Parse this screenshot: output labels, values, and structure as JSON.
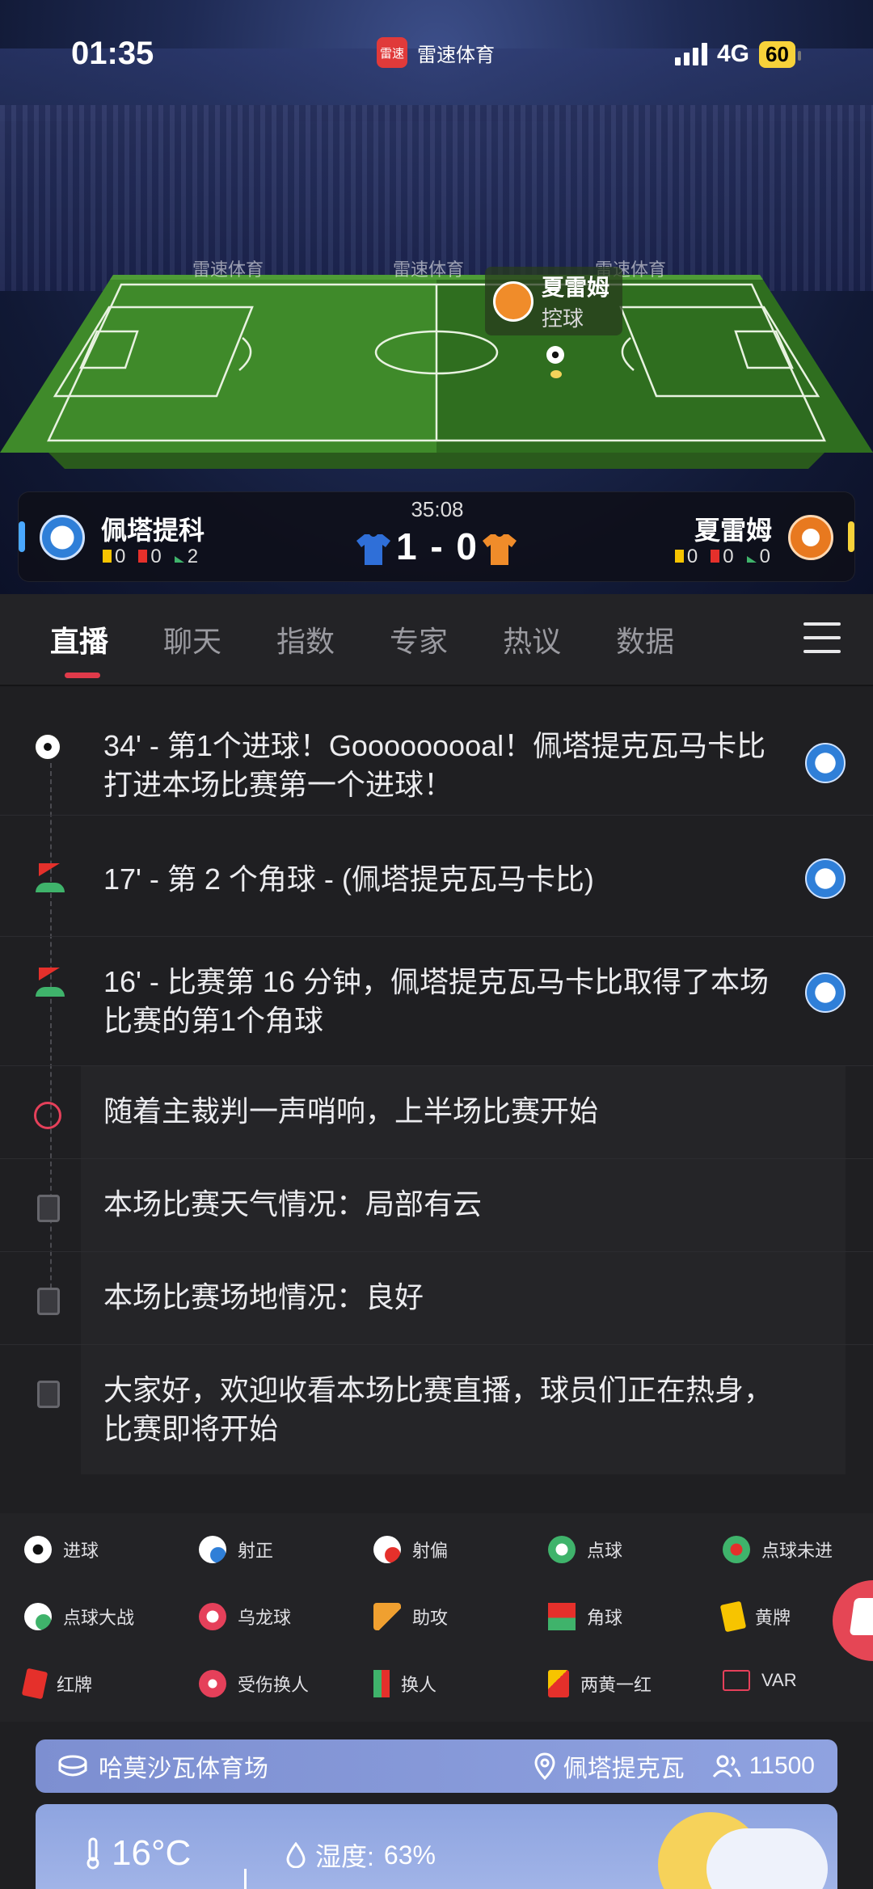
{
  "status_bar": {
    "time": "01:35",
    "app_name": "雷速体育",
    "app_logo_text": "雷速",
    "network": "4G",
    "battery": "60"
  },
  "pitch": {
    "ad_text": "雷速体育",
    "possession_team": "夏雷姆",
    "possession_label": "控球"
  },
  "scoreboard": {
    "match_time": "35:08",
    "score": "1 - 0",
    "home": {
      "name": "佩塔提科",
      "yellow": "0",
      "red": "0",
      "corners": "2",
      "color": "#2f7fd8"
    },
    "away": {
      "name": "夏雷姆",
      "yellow": "0",
      "red": "0",
      "corners": "0",
      "color": "#e8791f"
    }
  },
  "tabs": [
    {
      "label": "直播",
      "active": true
    },
    {
      "label": "聊天"
    },
    {
      "label": "指数"
    },
    {
      "label": "专家"
    },
    {
      "label": "热议"
    },
    {
      "label": "数据"
    }
  ],
  "events": [
    {
      "icon": "goal-icon",
      "text": "34' - 第1个进球！Gooooooooal！佩塔提克瓦马卡比打进本场比赛第一个进球！",
      "team": "home"
    },
    {
      "icon": "corner-icon",
      "text": "17' - 第 2 个角球 - (佩塔提克瓦马卡比)",
      "team": "home"
    },
    {
      "icon": "corner-icon",
      "text": "16' - 比赛第 16 分钟，佩塔提克瓦马卡比取得了本场比赛的第1个角球",
      "team": "home"
    },
    {
      "icon": "whistle-icon",
      "text": "随着主裁判一声哨响，上半场比赛开始",
      "team": ""
    },
    {
      "icon": "clipboard-icon",
      "text": "本场比赛天气情况：局部有云",
      "team": ""
    },
    {
      "icon": "clipboard-icon",
      "text": "本场比赛场地情况：良好",
      "team": ""
    },
    {
      "icon": "clipboard-icon",
      "text": "大家好，欢迎收看本场比赛直播，球员们正在热身，比赛即将开始",
      "team": ""
    }
  ],
  "legend": [
    {
      "label": "进球",
      "icon": "goal-icon"
    },
    {
      "label": "射正",
      "icon": "shot-on-target-icon"
    },
    {
      "label": "射偏",
      "icon": "shot-off-target-icon"
    },
    {
      "label": "点球",
      "icon": "penalty-icon"
    },
    {
      "label": "点球未进",
      "icon": "penalty-missed-icon"
    },
    {
      "label": "点球大战",
      "icon": "penalty-shootout-icon"
    },
    {
      "label": "乌龙球",
      "icon": "own-goal-icon"
    },
    {
      "label": "助攻",
      "icon": "assist-icon"
    },
    {
      "label": "角球",
      "icon": "corner-icon"
    },
    {
      "label": "黄牌",
      "icon": "yellow-card-icon"
    },
    {
      "label": "红牌",
      "icon": "red-card-icon"
    },
    {
      "label": "受伤换人",
      "icon": "injury-sub-icon"
    },
    {
      "label": "换人",
      "icon": "substitution-icon"
    },
    {
      "label": "两黄一红",
      "icon": "second-yellow-icon"
    },
    {
      "label": "VAR",
      "icon": "var-icon"
    }
  ],
  "venue": {
    "stadium": "哈莫沙瓦体育场",
    "city": "佩塔提克瓦",
    "capacity": "11500"
  },
  "weather": {
    "temperature": "16°C",
    "humidity_label": "湿度:",
    "humidity": "63%"
  }
}
